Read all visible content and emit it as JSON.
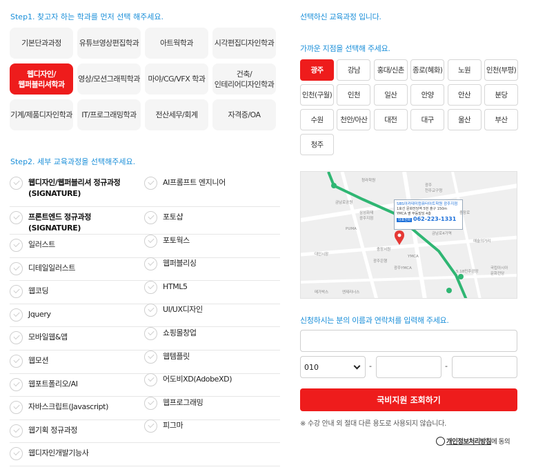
{
  "step1": {
    "title": "Step1. 찾고자 하는 학과를 먼저 선택 해주세요."
  },
  "departments": [
    {
      "label": "기본단과과정",
      "active": false
    },
    {
      "label": "유튜브영상편집학과",
      "active": false
    },
    {
      "label": "아트웍학과",
      "active": false
    },
    {
      "label": "시각편집디자인학과",
      "active": false
    },
    {
      "label": "웹디자인/\n웹퍼블리셔학과",
      "active": true
    },
    {
      "label": "영상/모션그래픽학과",
      "active": false
    },
    {
      "label": "마야/CG/VFX 학과",
      "active": false
    },
    {
      "label": "건축/\n인테리어디자인학과",
      "active": false
    },
    {
      "label": "기계/제품디자인학과",
      "active": false
    },
    {
      "label": "IT/프로그래밍학과",
      "active": false
    },
    {
      "label": "전산세무/회계",
      "active": false
    },
    {
      "label": "자격증/OA",
      "active": false
    }
  ],
  "step2": {
    "title": "Step2. 세부 교육과정을 선택해주세요."
  },
  "courses_left": [
    {
      "label": "웹디자인/웹퍼블리셔 정규과정\n(SIGNATURE)",
      "bold": true
    },
    {
      "label": "프론트엔드 정규과정 (SIGNATURE)",
      "bold": true
    },
    {
      "label": "일러스트",
      "bold": false
    },
    {
      "label": "디테일일러스트",
      "bold": false
    },
    {
      "label": "웹코딩",
      "bold": false
    },
    {
      "label": "Jquery",
      "bold": false
    },
    {
      "label": "모바일웹&앱",
      "bold": false
    },
    {
      "label": "웹모션",
      "bold": false
    },
    {
      "label": "웹포트폴리오/AI",
      "bold": false
    },
    {
      "label": "자바스크립트(Javascript)",
      "bold": false
    },
    {
      "label": "웹기획 정규과정",
      "bold": false
    },
    {
      "label": "웹디자인개발기능사",
      "bold": false
    }
  ],
  "courses_right": [
    {
      "label": "AI프롬프트 엔지니어"
    },
    {
      "label": "포토샵"
    },
    {
      "label": "포토웍스"
    },
    {
      "label": "웹퍼블리싱"
    },
    {
      "label": "HTML5"
    },
    {
      "label": "UI/UX디자인"
    },
    {
      "label": "쇼핑몰창업"
    },
    {
      "label": "웹템플릿"
    },
    {
      "label": "어도비XD(AdobeXD)"
    },
    {
      "label": "웹프로그래밍"
    },
    {
      "label": "피그마"
    }
  ],
  "selected_course": {
    "title": "선택하신 교육과정 입니다."
  },
  "branch_section": {
    "title": "가까운 지점을 선택해 주세요."
  },
  "branches": [
    {
      "label": "광주",
      "active": true
    },
    {
      "label": "강남",
      "active": false
    },
    {
      "label": "홍대/신촌",
      "active": false
    },
    {
      "label": "종로(혜화)",
      "active": false
    },
    {
      "label": "노원",
      "active": false
    },
    {
      "label": "인천(부평)",
      "active": false
    },
    {
      "label": "인천(구월)",
      "active": false
    },
    {
      "label": "인천",
      "active": false
    },
    {
      "label": "일산",
      "active": false
    },
    {
      "label": "안양",
      "active": false
    },
    {
      "label": "안산",
      "active": false
    },
    {
      "label": "분당",
      "active": false
    },
    {
      "label": "수원",
      "active": false
    },
    {
      "label": "천안/아산",
      "active": false
    },
    {
      "label": "대전",
      "active": false
    },
    {
      "label": "대구",
      "active": false
    },
    {
      "label": "울산",
      "active": false
    },
    {
      "label": "부산",
      "active": false
    },
    {
      "label": "청주",
      "active": false
    }
  ],
  "map": {
    "info_title": "SBS아카데미컴퓨터아트학원 광주지점",
    "info_addr1": "1호선 문화전당역 5번 출구 150m",
    "info_addr2": "YMCA 옆 무등빌딩 4층",
    "info_badge": "대표전화",
    "info_phone": "062-223-1331",
    "labels": [
      "청라학원",
      "광주\n천주교구청",
      "금남로공원",
      "삼성화재\n광주지점",
      "PUMA",
      "충장서원",
      "YMCA",
      "광주YMCA",
      "예술의거리",
      "금남로4가역",
      "대인시장",
      "5.18민주광장",
      "국립아시아\n문화전당",
      "메가박스",
      "엔제리너스",
      "충장로",
      "광주은행"
    ]
  },
  "applicant": {
    "title": "신청하시는 분의 이름과 연락처를 입력해 주세요.",
    "name_value": "",
    "phone_prefix": "010",
    "dash": "-",
    "phone_mid": "",
    "phone_last": ""
  },
  "submit": {
    "label": "국비지원 조회하기"
  },
  "note": "※ 수강 안내 외 절대 다른 용도로 사용되지 않습니다.",
  "privacy": {
    "link": "개인정보처리방침",
    "tail": "에 동의"
  },
  "colors": {
    "accent": "#ee1c1c",
    "step_blue": "#1b8fd9"
  }
}
